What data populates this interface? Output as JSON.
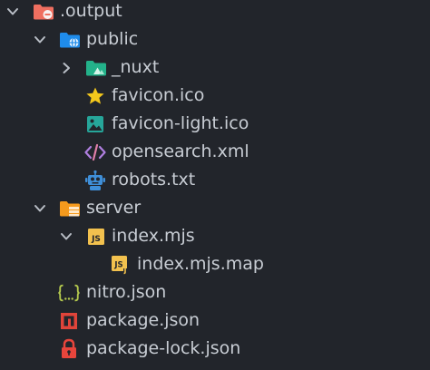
{
  "explorer": {
    "items": [
      {
        "label": ".output",
        "icon": "folder-output-icon",
        "chevron": "expanded"
      },
      {
        "label": "public",
        "icon": "folder-public-icon",
        "chevron": "expanded"
      },
      {
        "label": "_nuxt",
        "icon": "folder-nuxt-icon",
        "chevron": "collapsed"
      },
      {
        "label": "favicon.ico",
        "icon": "favicon-star-icon"
      },
      {
        "label": "favicon-light.ico",
        "icon": "image-file-icon"
      },
      {
        "label": "opensearch.xml",
        "icon": "xml-file-icon"
      },
      {
        "label": "robots.txt",
        "icon": "robot-file-icon"
      },
      {
        "label": "server",
        "icon": "folder-server-icon",
        "chevron": "expanded"
      },
      {
        "label": "index.mjs",
        "icon": "js-file-icon",
        "chevron": "expanded"
      },
      {
        "label": "index.mjs.map",
        "icon": "js-map-file-icon"
      },
      {
        "label": "nitro.json",
        "icon": "json-file-icon"
      },
      {
        "label": "package.json",
        "icon": "npm-package-icon"
      },
      {
        "label": "package-lock.json",
        "icon": "lock-file-icon"
      }
    ]
  },
  "colors": {
    "background": "#22252b",
    "text": "#c8cdd4",
    "chevron": "#b9bec6",
    "output_folder": "#ef6f60",
    "public_folder": "#1f8ceb",
    "nuxt_folder": "#23b28a",
    "star": "#f4c81c",
    "image": "#26a69a",
    "xml": "#b07fe0",
    "robot": "#3f8fd8",
    "server_folder": "#f59a1d",
    "js": "#f2c14e",
    "json": "#b4c94e",
    "npm": "#e0443a",
    "lock": "#e8453c"
  }
}
